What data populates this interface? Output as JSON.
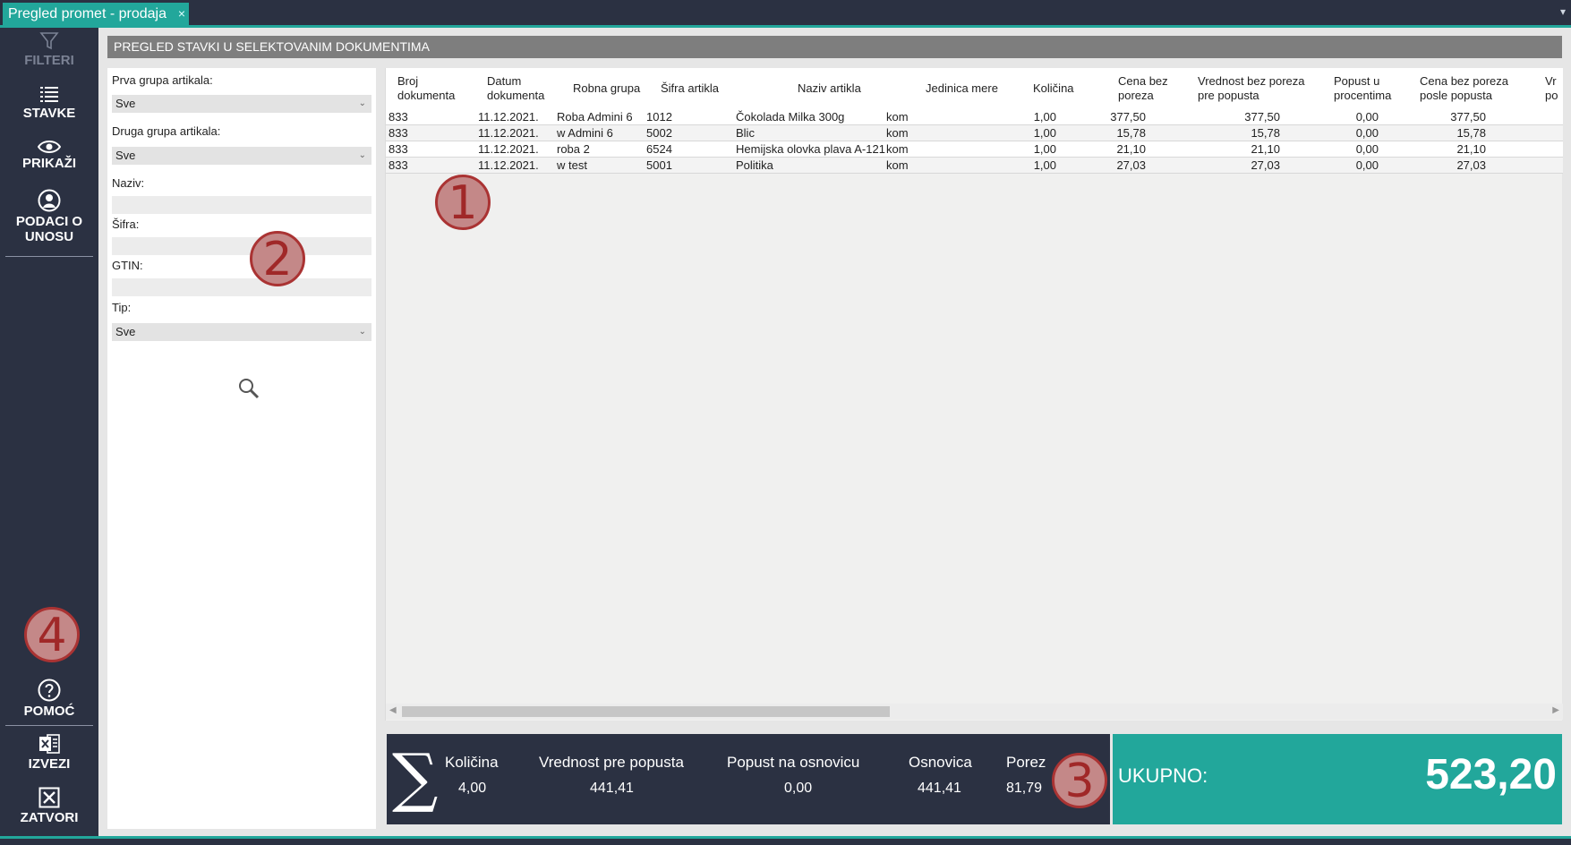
{
  "tab": {
    "title": "Pregled promet - prodaja",
    "close": "×",
    "menu": "▾"
  },
  "sidebar": {
    "filteri": "FILTERI",
    "stavke": "STAVKE",
    "prikazi": "PRIKAŽI",
    "podaci_line1": "PODACI O",
    "podaci_line2": "UNOSU",
    "pomoc": "POMOĆ",
    "izvezi": "IZVEZI",
    "zatvori": "ZATVORI"
  },
  "header": {
    "title": "PREGLED STAVKI U SELEKTOVANIM DOKUMENTIMA"
  },
  "filters": {
    "prva_grupa_label": "Prva grupa artikala:",
    "prva_grupa_value": "Sve",
    "druga_grupa_label": "Druga grupa artikala:",
    "druga_grupa_value": "Sve",
    "naziv_label": "Naziv:",
    "sifra_label": "Šifra:",
    "gtin_label": "GTIN:",
    "tip_label": "Tip:",
    "tip_value": "Sve"
  },
  "table": {
    "headers": {
      "broj_1": "Broj",
      "broj_2": "dokumenta",
      "datum_1": "Datum",
      "datum_2": "dokumenta",
      "robna": "Robna grupa",
      "sifra": "Šifra artikla",
      "naziv": "Naziv artikla",
      "jedinica": "Jedinica mere",
      "kolicina": "Količina",
      "cena_1": "Cena bez",
      "cena_2": "poreza",
      "vred_1": "Vrednost bez poreza",
      "vred_2": "pre popusta",
      "popust_1": "Popust u",
      "popust_2": "procentima",
      "cena_posle_1": "Cena bez poreza",
      "cena_posle_2": "posle popusta",
      "more_1": "Vr",
      "more_2": "po"
    },
    "rows": [
      {
        "broj": "833",
        "datum": "11.12.2021.",
        "robna": "Roba Admini 6",
        "sifra": "1012",
        "naziv": "Čokolada Milka 300g",
        "jm": "kom",
        "kolicina": "1,00",
        "cena": "377,50",
        "vrednost": "377,50",
        "popust": "0,00",
        "cena_posle": "377,50"
      },
      {
        "broj": "833",
        "datum": "11.12.2021.",
        "robna": "w Admini 6",
        "sifra": "5002",
        "naziv": "Blic",
        "jm": "kom",
        "kolicina": "1,00",
        "cena": "15,78",
        "vrednost": "15,78",
        "popust": "0,00",
        "cena_posle": "15,78"
      },
      {
        "broj": "833",
        "datum": "11.12.2021.",
        "robna": "roba 2",
        "sifra": "6524",
        "naziv": "Hemijska olovka plava A-121",
        "jm": "kom",
        "kolicina": "1,00",
        "cena": "21,10",
        "vrednost": "21,10",
        "popust": "0,00",
        "cena_posle": "21,10"
      },
      {
        "broj": "833",
        "datum": "11.12.2021.",
        "robna": "w test",
        "sifra": "5001",
        "naziv": "Politika",
        "jm": "kom",
        "kolicina": "1,00",
        "cena": "27,03",
        "vrednost": "27,03",
        "popust": "0,00",
        "cena_posle": "27,03"
      }
    ]
  },
  "totals": {
    "sigma": "∑",
    "kolicina_label": "Količina",
    "kolicina_value": "4,00",
    "vrednost_label": "Vrednost pre popusta",
    "vrednost_value": "441,41",
    "popust_label": "Popust na osnovicu",
    "popust_value": "0,00",
    "osnovica_label": "Osnovica",
    "osnovica_value": "441,41",
    "porez_label": "Porez",
    "porez_value": "81,79",
    "ukupno_label": "UKUPNO:",
    "ukupno_value": "523,20"
  },
  "callouts": {
    "c1": "1",
    "c2": "2",
    "c3": "3",
    "c4": "4"
  },
  "colors": {
    "teal": "#22a79b",
    "navy": "#2b3142",
    "callout": "#c48888"
  }
}
